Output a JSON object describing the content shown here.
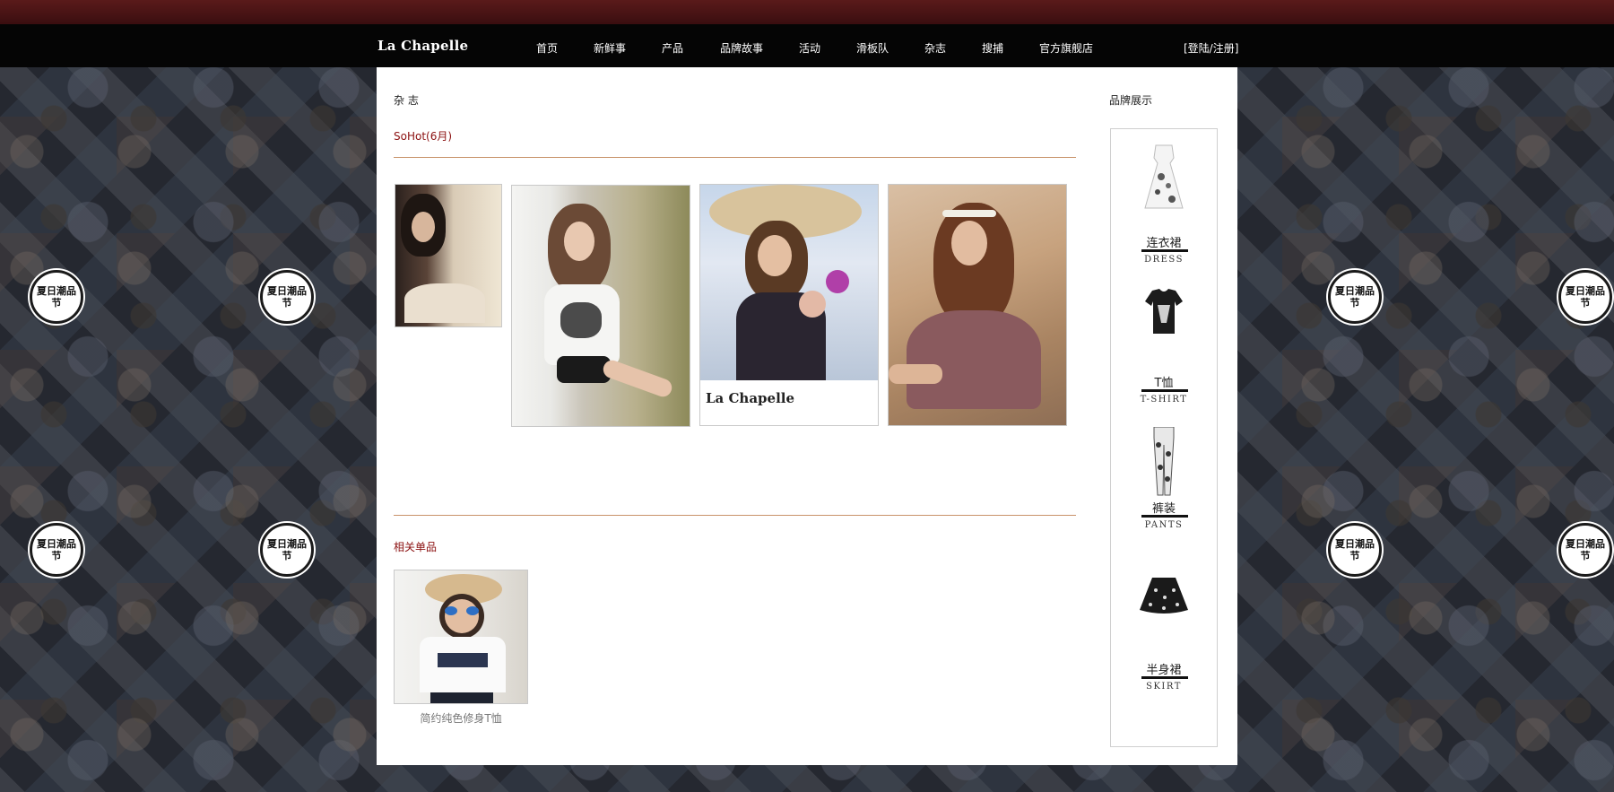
{
  "header": {
    "logo": "La Chapelle",
    "nav": [
      "首页",
      "新鲜事",
      "产品",
      "品牌故事",
      "活动",
      "滑板队",
      "杂志",
      "搜捕",
      "官方旗舰店"
    ],
    "login": "[登陆/注册]"
  },
  "background": {
    "badge_text": "夏日潮品节"
  },
  "main": {
    "section_title": "杂 志",
    "issue_title": "SoHot(6月)",
    "photo_card_caption": "La Chapelle",
    "related_title": "相关单品",
    "product_name": "简约纯色修身T恤"
  },
  "sidebar": {
    "title": "品牌展示",
    "categories": [
      {
        "cn": "连衣裙",
        "en": "DRESS",
        "icon": "dress-icon"
      },
      {
        "cn": "T恤",
        "en": "T-SHIRT",
        "icon": "tshirt-icon"
      },
      {
        "cn": "裤装",
        "en": "PANTS",
        "icon": "pants-icon"
      },
      {
        "cn": "半身裙",
        "en": "SKIRT",
        "icon": "skirt-icon"
      }
    ]
  },
  "colors": {
    "accent_red": "#8b1010",
    "rule_tan": "#c8926a",
    "nav_bg": "#050505",
    "top_bar": "#4a1416"
  }
}
